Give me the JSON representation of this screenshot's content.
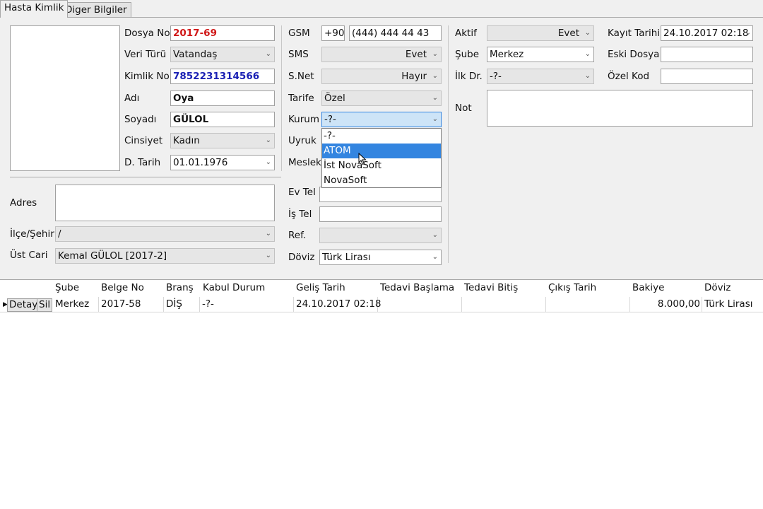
{
  "tabs": [
    "Hasta Kimlik",
    "Diger Bilgiler"
  ],
  "patient": {
    "dosya_no": {
      "label": "Dosya No",
      "value": "2017-69"
    },
    "veri_turu": {
      "label": "Veri Türü",
      "value": "Vatandaş"
    },
    "kimlik_no": {
      "label": "Kimlik No",
      "value": "7852231314566"
    },
    "adi": {
      "label": "Adı",
      "value": "Oya"
    },
    "soyadi": {
      "label": "Soyadı",
      "value": "GÜLOL"
    },
    "cinsiyet": {
      "label": "Cinsiyet",
      "value": "Kadın"
    },
    "d_tarih": {
      "label": "D. Tarih",
      "value": "01.01.1976"
    }
  },
  "contact": {
    "gsm": {
      "label": "GSM",
      "code": "+90",
      "value": "(444) 444 44 43"
    },
    "sms": {
      "label": "SMS",
      "value": "Evet"
    },
    "snet": {
      "label": "S.Net",
      "value": "Hayır"
    },
    "tarife": {
      "label": "Tarife",
      "value": "Özel"
    },
    "kurum": {
      "label": "Kurum",
      "value": "-?-"
    },
    "uyruk": {
      "label": "Uyruk"
    },
    "meslek": {
      "label": "Meslek"
    }
  },
  "status": {
    "aktif": {
      "label": "Aktif",
      "value": "Evet"
    },
    "sube": {
      "label": "Şube",
      "value": "Merkez"
    },
    "ilk_dr": {
      "label": "İlk Dr.",
      "value": "-?-"
    },
    "not": {
      "label": "Not",
      "value": ""
    }
  },
  "registry": {
    "kayit_tarihi": {
      "label": "Kayıt Tarihi",
      "value": "24.10.2017 02:18"
    },
    "eski_dosya": {
      "label": "Eski Dosya",
      "value": ""
    },
    "ozel_kod": {
      "label": "Özel Kod",
      "value": ""
    }
  },
  "address": {
    "adres": {
      "label": "Adres",
      "value": ""
    },
    "ilce_sehir": {
      "label": "İlçe/Şehir",
      "value": "/"
    },
    "ust_cari": {
      "label": "Üst Cari",
      "value": "Kemal GÜLOL [2017-2]"
    }
  },
  "phones": {
    "ev_tel": {
      "label": "Ev Tel",
      "value": ""
    },
    "is_tel": {
      "label": "İş Tel",
      "value": ""
    },
    "ref": {
      "label": "Ref.",
      "value": ""
    },
    "doviz": {
      "label": "Döviz",
      "value": "Türk Lirası"
    }
  },
  "kurum_dropdown": {
    "options": [
      "-?-",
      "ATOM",
      "İst NovaSoft",
      "NovaSoft"
    ],
    "highlighted": "ATOM"
  },
  "grid": {
    "columns": [
      "Şube",
      "Belge No",
      "Branş",
      "Kabul Durum",
      "Geliş Tarih",
      "Tedavi Başlama",
      "Tedavi Bitiş",
      "Çıkış Tarih",
      "Bakiye",
      "Döviz"
    ],
    "buttons": {
      "detay": "Detay",
      "sil": "Sil"
    },
    "rows": [
      {
        "sube": "Merkez",
        "belge_no": "2017-58",
        "brans": "DİŞ",
        "kabul_durum": "-?-",
        "gelis_tarih": "24.10.2017 02:18",
        "tedavi_baslama": "",
        "tedavi_bitis": "",
        "cikis_tarih": "",
        "bakiye": "8.000,00",
        "doviz": "Türk Lirası"
      }
    ]
  },
  "colors": {
    "red_value": "#d01818",
    "blue_value": "#1a20b4",
    "selection": "#3385e0"
  },
  "icons": [
    "chevron-down-icon",
    "mouse-pointer-icon",
    "row-indicator-icon"
  ]
}
